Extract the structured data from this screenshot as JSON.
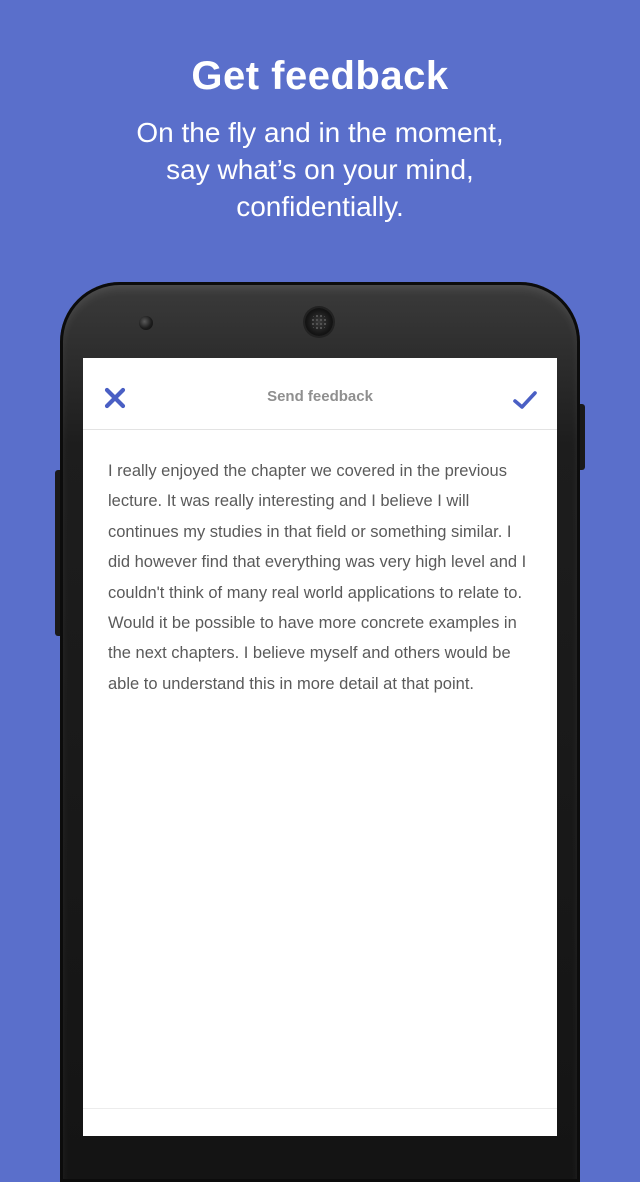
{
  "hero": {
    "title": "Get feedback",
    "subtitle_lines": [
      "On the fly and in the moment,",
      "say what’s on your mind,",
      "confidentially."
    ]
  },
  "app_bar": {
    "title": "Send feedback",
    "close_icon": "close-icon",
    "confirm_icon": "checkmark-icon"
  },
  "feedback": {
    "text": "I really enjoyed the chapter we covered in the previous lecture. It was really interesting and I believe I will continues my studies in that field or something similar. I did however find that everything was very high level and I couldn't think of many real world applications to relate to. Would it be possible to have more concrete examples in the next chapters. I believe myself and others would be able to understand this in more detail at that point."
  },
  "colors": {
    "background": "#5a6fcb",
    "accent": "#4a5fc4",
    "title_gray": "#8f8f8f",
    "body_text": "#5a5a5a"
  }
}
